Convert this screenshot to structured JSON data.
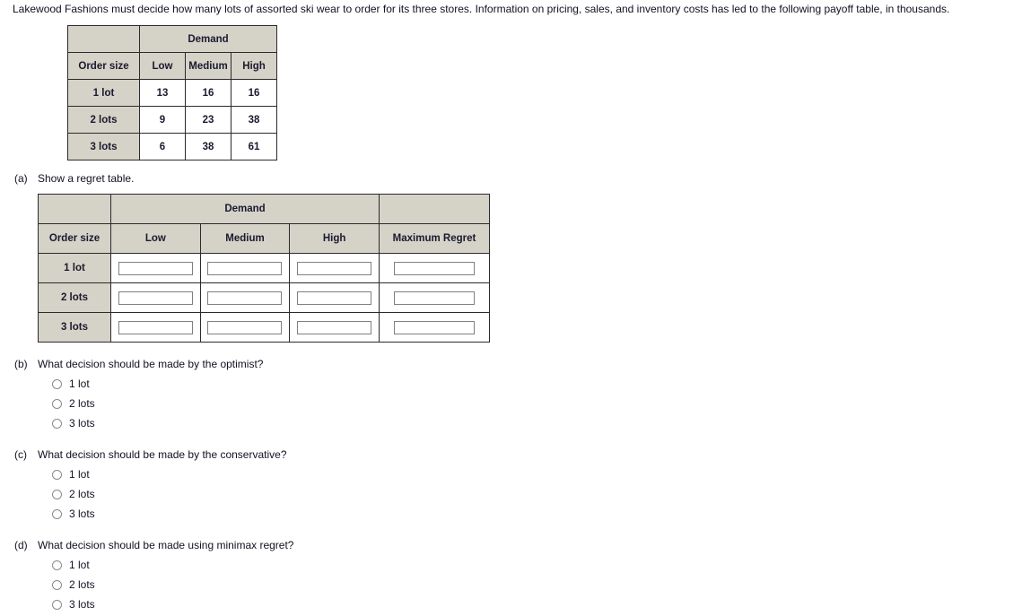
{
  "intro": "Lakewood Fashions must decide how many lots of assorted ski wear to order for its three stores. Information on pricing, sales, and inventory costs has led to the following payoff table, in thousands.",
  "colors": {
    "header_bg": "#d5d2c8",
    "value_text": "#cc2222",
    "border": "#2b2b2b",
    "body_text": "#111122",
    "input_border": "#808080"
  },
  "payoff_table": {
    "group_header": "Demand",
    "corner_label": "",
    "row_header": "Order size",
    "columns": [
      "Low",
      "Medium",
      "High"
    ],
    "rows": [
      {
        "label": "1 lot",
        "values": [
          "13",
          "16",
          "16"
        ]
      },
      {
        "label": "2 lots",
        "values": [
          "9",
          "23",
          "38"
        ]
      },
      {
        "label": "3 lots",
        "values": [
          "6",
          "38",
          "61"
        ]
      }
    ]
  },
  "part_a": {
    "letter": "(a)",
    "text": "Show a regret table."
  },
  "regret_table": {
    "group_header": "Demand",
    "corner_label": "",
    "extra_corner_label": "",
    "row_header": "Order size",
    "columns": [
      "Low",
      "Medium",
      "High"
    ],
    "max_regret_header": "Maximum Regret",
    "rows": [
      {
        "label": "1 lot",
        "values": [
          "",
          "",
          ""
        ],
        "max_regret": ""
      },
      {
        "label": "2 lots",
        "values": [
          "",
          "",
          ""
        ],
        "max_regret": ""
      },
      {
        "label": "3 lots",
        "values": [
          "",
          "",
          ""
        ],
        "max_regret": ""
      }
    ],
    "input_placeholder": ""
  },
  "questions": [
    {
      "letter": "(b)",
      "text": "What decision should be made by the optimist?",
      "options": [
        "1 lot",
        "2 lots",
        "3 lots"
      ]
    },
    {
      "letter": "(c)",
      "text": "What decision should be made by the conservative?",
      "options": [
        "1 lot",
        "2 lots",
        "3 lots"
      ]
    },
    {
      "letter": "(d)",
      "text": "What decision should be made using minimax regret?",
      "options": [
        "1 lot",
        "2 lots",
        "3 lots"
      ]
    }
  ]
}
